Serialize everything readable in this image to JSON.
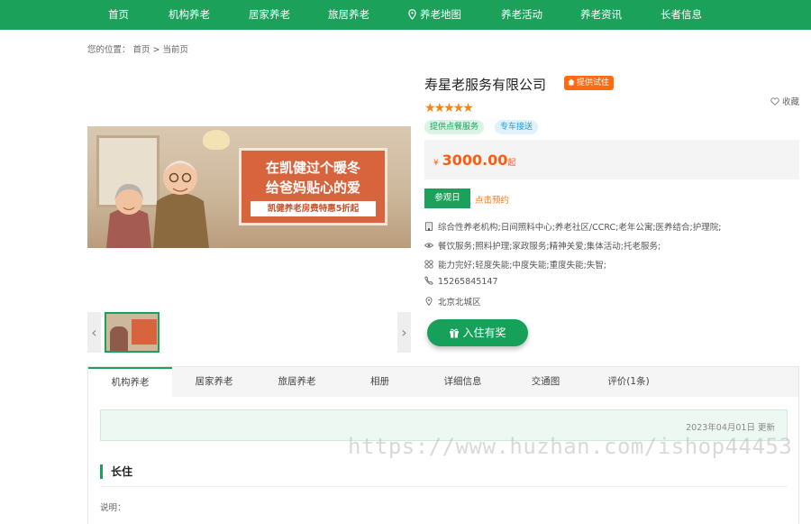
{
  "nav": {
    "items": [
      "首页",
      "机构养老",
      "居家养老",
      "旅居养老",
      "养老地图",
      "养老活动",
      "养老资讯",
      "长者信息"
    ],
    "map_icon": "map-pin-icon"
  },
  "breadcrumb": {
    "label": "您的位置：",
    "home": "首页",
    "sep": ">",
    "current": "当前页"
  },
  "hero": {
    "line1": "在凯健过个暖冬",
    "line2": "给爸妈贴心的爱",
    "sub": "凯健养老房费特惠5折起"
  },
  "org": {
    "name": "寿星老服务有限公司",
    "trial_badge": "提供试住",
    "favorite": "收藏",
    "stars": "★★★★★",
    "tags": [
      "提供点餐服务",
      "专车接送"
    ],
    "price_currency": "¥",
    "price": "3000.00",
    "price_suffix": "起",
    "visit_button": "参观日",
    "reserve_link": "点击预约",
    "types": "综合性养老机构;日间照料中心;养老社区/CCRC;老年公寓;医养结合;护理院;",
    "services": "餐饮服务;照料护理;家政服务;精神关爱;集体活动;托老服务;",
    "abilities": "能力完好;轻度失能;中度失能;重度失能;失智;",
    "phone": "15265845147",
    "address": "北京北城区",
    "cta": "入住有奖"
  },
  "tabs": [
    "机构养老",
    "居家养老",
    "旅居养老",
    "相册",
    "详细信息",
    "交通图",
    "评价(1条)"
  ],
  "content": {
    "updated": "2023年04月01日 更新",
    "section_title": "长住",
    "desc_label": "说明："
  },
  "watermark": "https://www.huzhan.com/ishop44453",
  "colors": {
    "brand_green": "#1ca15a",
    "price_orange": "#ff5b12",
    "badge_orange": "#ff6a13",
    "star": "#f08519"
  }
}
